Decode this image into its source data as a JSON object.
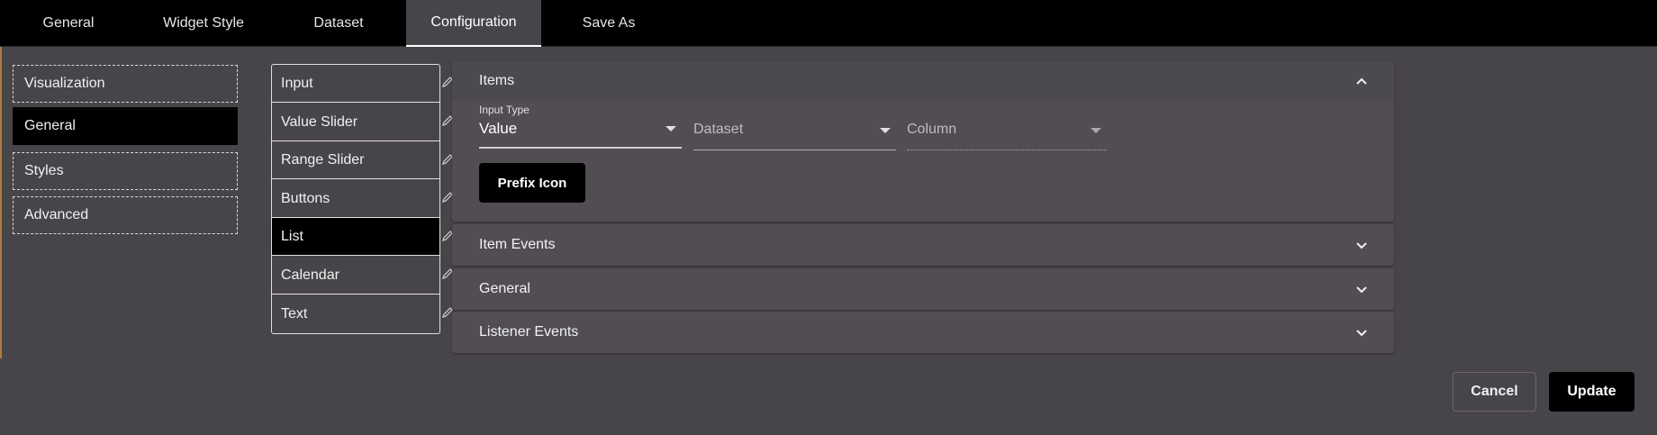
{
  "tabs": [
    {
      "label": "General"
    },
    {
      "label": "Widget Style"
    },
    {
      "label": "Dataset"
    },
    {
      "label": "Configuration"
    },
    {
      "label": "Save As"
    }
  ],
  "active_tab": "Configuration",
  "nav": [
    {
      "label": "Visualization"
    },
    {
      "label": "General"
    },
    {
      "label": "Styles"
    },
    {
      "label": "Advanced"
    }
  ],
  "active_nav": "General",
  "widgets": [
    {
      "label": "Input"
    },
    {
      "label": "Value Slider"
    },
    {
      "label": "Range Slider"
    },
    {
      "label": "Buttons"
    },
    {
      "label": "List"
    },
    {
      "label": "Calendar"
    },
    {
      "label": "Text"
    }
  ],
  "active_widget": "List",
  "panels": {
    "items": {
      "title": "Items",
      "input_type_label": "Input Type",
      "input_type_value": "Value",
      "dataset_placeholder": "Dataset",
      "column_placeholder": "Column",
      "prefix_icon_label": "Prefix Icon"
    },
    "item_events": {
      "title": "Item Events"
    },
    "general": {
      "title": "General"
    },
    "listener_events": {
      "title": "Listener Events"
    }
  },
  "footer": {
    "cancel_label": "Cancel",
    "update_label": "Update"
  },
  "colors": {
    "background": "#48454a",
    "panel": "#514d53",
    "active": "#000000"
  },
  "icons": [
    "pencil-icon",
    "chevron-up-icon",
    "chevron-down-icon",
    "dropdown-arrow-icon"
  ]
}
